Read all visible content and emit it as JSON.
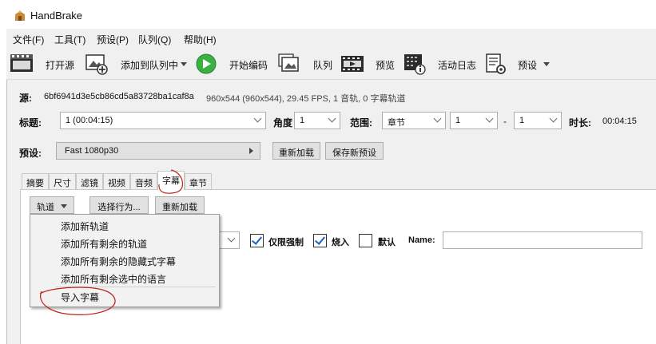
{
  "window": {
    "title": "HandBrake"
  },
  "menubar": [
    "文件(F)",
    "工具(T)",
    "预设(P)",
    "队列(Q)",
    "帮助(H)"
  ],
  "toolbar": {
    "open_source": "打开源",
    "add_to_queue": "添加到队列中",
    "start_encode": "开始编码",
    "queue": "队列",
    "preview": "预览",
    "activity_log": "活动日志",
    "presets": "预设"
  },
  "source": {
    "label": "源:",
    "filename": "6bf6941d3e5cb86cd5a83728ba1caf8a",
    "info": "960x544 (960x544), 29.45 FPS, 1 音轨, 0 字幕轨道"
  },
  "title_row": {
    "title_label": "标题:",
    "title_value": "1 (00:04:15)",
    "angle_label": "角度",
    "angle_value": "1",
    "range_label": "范围:",
    "range_type": "章节",
    "range_start": "1",
    "range_sep": "-",
    "range_end": "1",
    "duration_label": "时长:",
    "duration_value": "00:04:15"
  },
  "preset_row": {
    "label": "预设:",
    "value": "Fast 1080p30",
    "reload": "重新加载",
    "save_new": "保存新预设"
  },
  "tabs": [
    "摘要",
    "尺寸",
    "滤镜",
    "视频",
    "音频",
    "字幕",
    "章节"
  ],
  "active_tab": "字幕",
  "subtitles": {
    "tracks_button": "轨道",
    "choose_behavior": "选择行为...",
    "reload": "重新加载",
    "forced_only": "仅限强制",
    "burn_in": "烧入",
    "default": "默认",
    "name_label": "Name:",
    "name_value": ""
  },
  "tracks_menu": [
    "添加新轨道",
    "添加所有剩余的轨道",
    "添加所有剩余的隐藏式字幕",
    "添加所有剩余选中的语言",
    "导入字幕"
  ],
  "colors": {
    "accent": "#1463c7",
    "start_green": "#3cb043",
    "annotation_red": "#c0201a"
  }
}
